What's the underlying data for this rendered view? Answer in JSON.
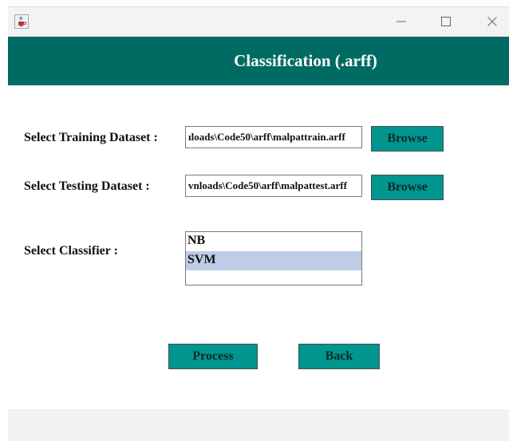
{
  "window": {
    "app_icon": "java-cup-icon",
    "controls": [
      "minimize-icon",
      "maximize-icon",
      "close-icon"
    ]
  },
  "header": {
    "title": "Classification (.arff)",
    "background": "#006b63"
  },
  "form": {
    "training": {
      "label": "Select Training Dataset :",
      "value": "ıloads\\Code50\\arff\\malpattrain.arff",
      "browse_label": "Browse"
    },
    "testing": {
      "label": "Select Testing Dataset :",
      "value": "vnloads\\Code50\\arff\\malpattest.arff",
      "browse_label": "Browse"
    },
    "classifier": {
      "label": "Select Classifier :",
      "options": [
        "NB",
        "SVM"
      ],
      "selected": "SVM"
    }
  },
  "actions": {
    "process_label": "Process",
    "back_label": "Back"
  },
  "colors": {
    "button": "#00958f",
    "selection": "#bccde5"
  }
}
